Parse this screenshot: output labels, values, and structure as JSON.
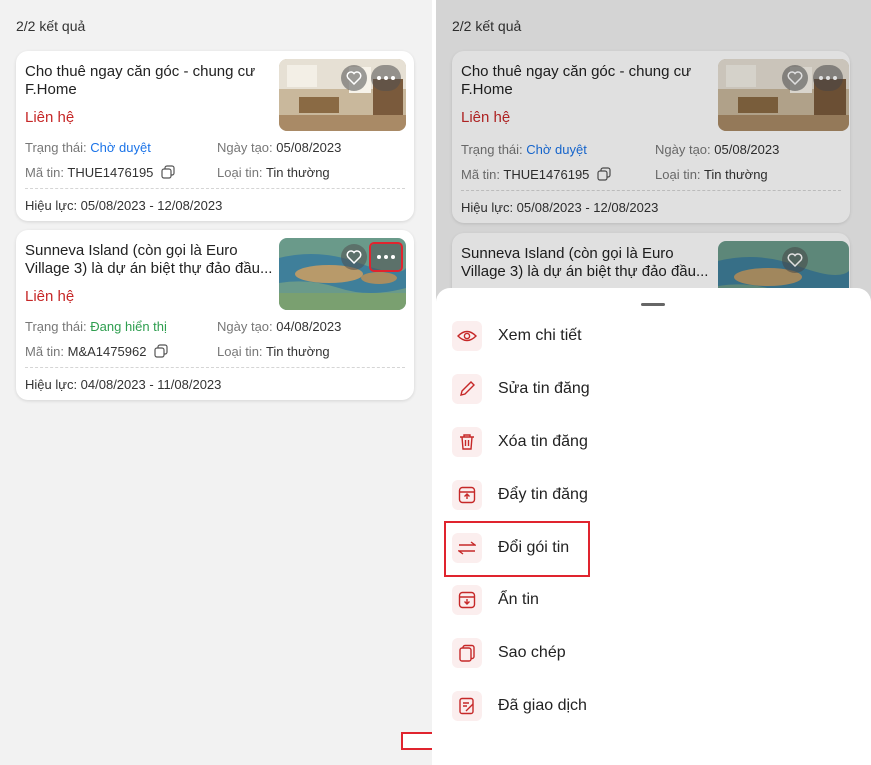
{
  "results_count": "2/2 kết quả",
  "listings": [
    {
      "title": "Cho thuê ngay căn góc - chung cư F.Home",
      "contact": "Liên hệ",
      "status_label": "Trạng thái:",
      "status_value": "Chờ duyệt",
      "created_label": "Ngày tạo:",
      "created_value": "05/08/2023",
      "code_label": "Mã tin:",
      "code_value": "THUE1476195",
      "type_label": "Loại tin:",
      "type_value": "Tin thường",
      "validity": "Hiệu lực: 05/08/2023 - 12/08/2023"
    },
    {
      "title": "Sunneva Island (còn gọi là Euro Village 3) là dự án biệt thự đảo đầu...",
      "contact": "Liên hệ",
      "status_label": "Trạng thái:",
      "status_value": "Đang hiển thị",
      "created_label": "Ngày tạo:",
      "created_value": "04/08/2023",
      "code_label": "Mã tin:",
      "code_value": "M&A1475962",
      "type_label": "Loại tin:",
      "type_value": "Tin thường",
      "validity": "Hiệu lực: 04/08/2023 - 11/08/2023"
    }
  ],
  "menu": [
    {
      "label": "Xem chi tiết",
      "icon": "eye-icon"
    },
    {
      "label": "Sửa tin đăng",
      "icon": "pencil-icon"
    },
    {
      "label": "Xóa tin đăng",
      "icon": "trash-icon"
    },
    {
      "label": "Đẩy tin đăng",
      "icon": "push-up-icon"
    },
    {
      "label": "Đổi gói tin",
      "icon": "swap-icon"
    },
    {
      "label": "Ẩn tin",
      "icon": "hide-download-icon"
    },
    {
      "label": "Sao chép",
      "icon": "copy-icon"
    },
    {
      "label": "Đã giao dịch",
      "icon": "done-document-icon"
    }
  ],
  "colors": {
    "accent": "#c62828",
    "highlight_box": "#e0242e",
    "status_pending": "#1a73e8",
    "status_active": "#2e9e4f"
  }
}
